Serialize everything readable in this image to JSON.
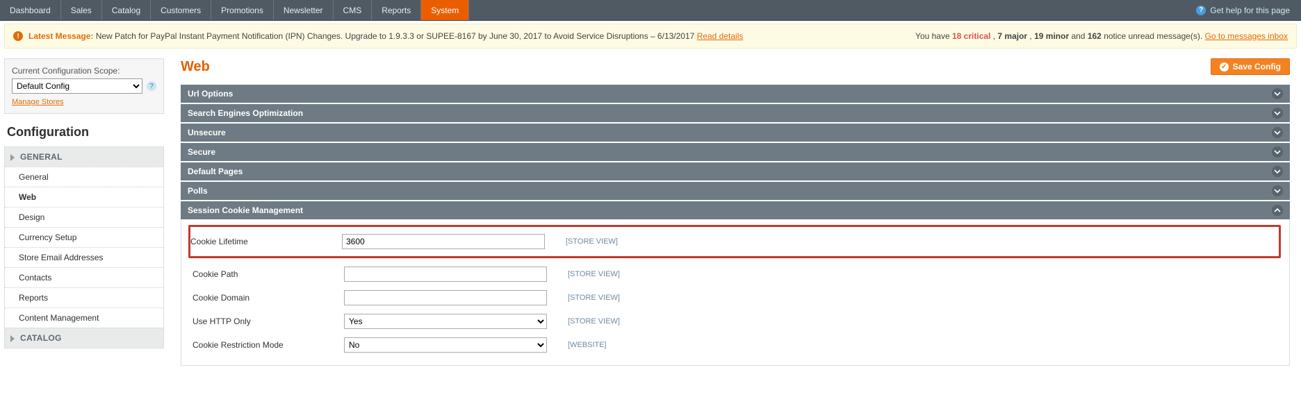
{
  "topnav": {
    "items": [
      "Dashboard",
      "Sales",
      "Catalog",
      "Customers",
      "Promotions",
      "Newsletter",
      "CMS",
      "Reports",
      "System"
    ],
    "active": "System",
    "help": "Get help for this page"
  },
  "msgbar": {
    "latest_label": "Latest Message:",
    "text_a": " New Patch for PayPal Instant Payment Notification (IPN) Changes. Upgrade to 1.9.3.3 or SUPEE-8167 by June 30, 2017 to Avoid Service Disruptions – 6/13/2017 ",
    "read_details": "Read details",
    "right_a": "You have ",
    "critical": "18 critical",
    "sep1": ", ",
    "major": "7 major",
    "sep2": ", ",
    "minor": "19 minor",
    "and": " and ",
    "notice": "162",
    "right_b": " notice unread message(s). ",
    "inbox": "Go to messages inbox"
  },
  "scope": {
    "label": "Current Configuration Scope:",
    "value": "Default Config",
    "manage": "Manage Stores"
  },
  "conf_title": "Configuration",
  "navgroups": [
    {
      "label": "GENERAL",
      "items": [
        "General",
        "Web",
        "Design",
        "Currency Setup",
        "Store Email Addresses",
        "Contacts",
        "Reports",
        "Content Management"
      ],
      "active": "Web"
    },
    {
      "label": "CATALOG",
      "items": []
    }
  ],
  "page": {
    "title": "Web",
    "save": "Save Config"
  },
  "sections": [
    {
      "title": "Url Options",
      "open": false
    },
    {
      "title": "Search Engines Optimization",
      "open": false
    },
    {
      "title": "Unsecure",
      "open": false
    },
    {
      "title": "Secure",
      "open": false
    },
    {
      "title": "Default Pages",
      "open": false
    },
    {
      "title": "Polls",
      "open": false
    },
    {
      "title": "Session Cookie Management",
      "open": true
    }
  ],
  "cookie": {
    "rows": [
      {
        "label": "Cookie Lifetime",
        "type": "text",
        "value": "3600",
        "scope": "[STORE VIEW]",
        "hl": true
      },
      {
        "label": "Cookie Path",
        "type": "text",
        "value": "",
        "scope": "[STORE VIEW]"
      },
      {
        "label": "Cookie Domain",
        "type": "text",
        "value": "",
        "scope": "[STORE VIEW]"
      },
      {
        "label": "Use HTTP Only",
        "type": "select",
        "value": "Yes",
        "scope": "[STORE VIEW]"
      },
      {
        "label": "Cookie Restriction Mode",
        "type": "select",
        "value": "No",
        "scope": "[WEBSITE]"
      }
    ]
  }
}
